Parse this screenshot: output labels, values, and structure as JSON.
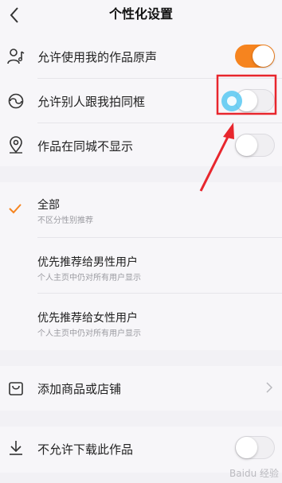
{
  "header": {
    "title": "个性化设置"
  },
  "section1": {
    "items": [
      {
        "label": "允许使用我的作品原声",
        "icon": "user-music-icon",
        "toggle": "on"
      },
      {
        "label": "允许别人跟我拍同框",
        "icon": "duet-icon",
        "toggle": "off"
      },
      {
        "label": "作品在同城不显示",
        "icon": "location-icon",
        "toggle": "off"
      }
    ]
  },
  "section2": {
    "options": [
      {
        "title": "全部",
        "subtitle": "不区分性别推荐",
        "selected": true
      },
      {
        "title": "优先推荐给男性用户",
        "subtitle": "个人主页中仍对所有用户显示",
        "selected": false
      },
      {
        "title": "优先推荐给女性用户",
        "subtitle": "个人主页中仍对所有用户显示",
        "selected": false
      }
    ]
  },
  "section3": {
    "label": "添加商品或店铺",
    "icon": "shopping-bag-icon"
  },
  "section4": {
    "label": "不允许下载此作品",
    "icon": "download-icon",
    "toggle": "off"
  },
  "colors": {
    "accent": "#f6841f",
    "annotation_red": "#e8262d",
    "tap_highlight": "#58c8f2"
  },
  "watermark": {
    "text": "Baidu 经验"
  }
}
